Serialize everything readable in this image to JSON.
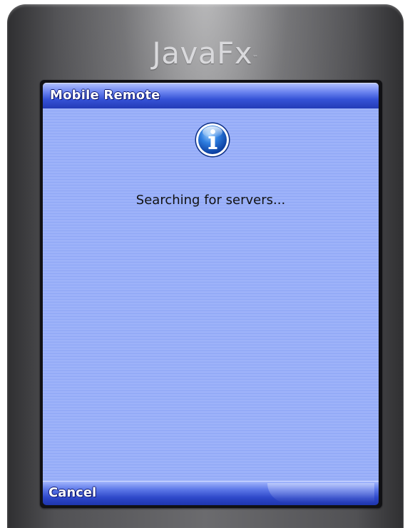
{
  "device": {
    "brand": "JavaFx",
    "brand_tm": "™"
  },
  "dialog": {
    "title": "Mobile Remote",
    "icon": "info-icon",
    "message": "Searching for servers..."
  },
  "softkeys": {
    "left_label": "Cancel"
  },
  "colors": {
    "titlebar_accent": "#2f4bd0",
    "content_background": "#95acf8",
    "device_body": "#5a5a5d"
  }
}
